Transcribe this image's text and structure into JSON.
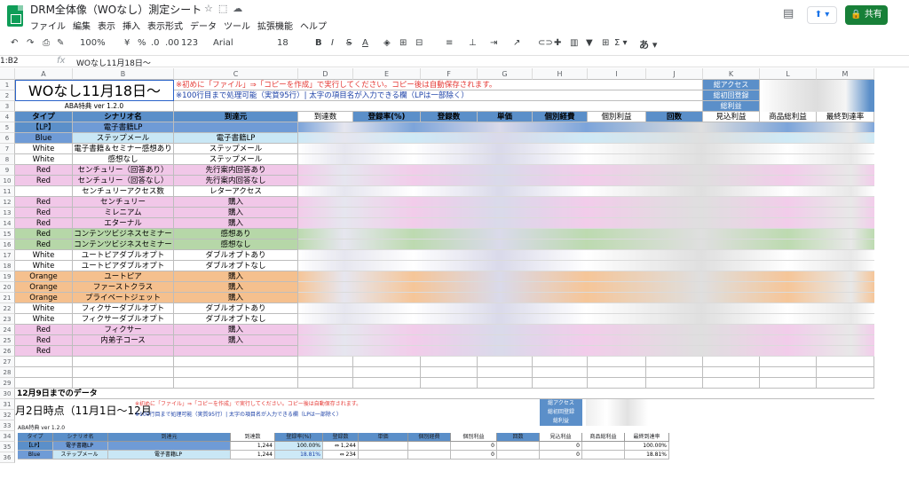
{
  "app": {
    "doc_title": "DRM全体像（WOなし）測定シート",
    "menus": [
      "ファイル",
      "編集",
      "表示",
      "挿入",
      "表示形式",
      "データ",
      "ツール",
      "拡張機能",
      "ヘルプ"
    ],
    "share_label": "共有"
  },
  "toolbar": {
    "zoom": "100%",
    "currency": "¥",
    "percent": "%",
    "dec_dec": ".0",
    "dec_inc": ".00",
    "number_format": "123",
    "font": "Arial",
    "font_size": "18"
  },
  "formula": {
    "namebox": "1:B2",
    "fx": "fx",
    "content": "WOなし11月18日〜"
  },
  "columns": [
    "A",
    "B",
    "C",
    "D",
    "E",
    "F",
    "G",
    "H",
    "I",
    "J",
    "K",
    "L",
    "M"
  ],
  "sheet": {
    "big_title": "WOなし11月18日〜",
    "version": "ABA特典 ver 1.2.0",
    "note1": "※初めに「ファイル」⇒「コピーを作成」で実行してください。コピー後は自動保存されます。",
    "note2": "※100行目まで処理可能（実質95行）| 太字の項目名が入力できる欄（LPは一部除く）",
    "k_labels": [
      "総アクセス",
      "総初回登録",
      "総利益"
    ],
    "headers": [
      "タイプ",
      "シナリオ名",
      "到達元",
      "到達数",
      "登録率(%)",
      "登録数",
      "単価",
      "個別経費",
      "個別利益",
      "回数",
      "見込利益",
      "商品総利益",
      "最終到達率"
    ],
    "rows": [
      {
        "type": "【LP】",
        "scenario": "電子書籍LP",
        "source": ""
      },
      {
        "type": "Blue",
        "scenario": "ステップメール",
        "source": "電子書籍LP"
      },
      {
        "type": "White",
        "scenario": "電子書籍＆セミナー感想あり",
        "source": "ステップメール"
      },
      {
        "type": "White",
        "scenario": "感想なし",
        "source": "ステップメール"
      },
      {
        "type": "Red",
        "scenario": "センチュリー（回答あり）",
        "source": "先行案内回答あり"
      },
      {
        "type": "Red",
        "scenario": "センチュリー（回答なし）",
        "source": "先行案内回答なし"
      },
      {
        "type": "",
        "scenario": "センチュリーアクセス数",
        "source": "レターアクセス"
      },
      {
        "type": "Red",
        "scenario": "センチュリー",
        "source": "購入"
      },
      {
        "type": "Red",
        "scenario": "ミレニアム",
        "source": "購入"
      },
      {
        "type": "Red",
        "scenario": "エターナル",
        "source": "購入"
      },
      {
        "type": "Red",
        "scenario": "コンテンツビジネスセミナー",
        "source": "感想あり"
      },
      {
        "type": "Red",
        "scenario": "コンテンツビジネスセミナー",
        "source": "感想なし"
      },
      {
        "type": "White",
        "scenario": "ユートピアダブルオプト",
        "source": "ダブルオプトあり"
      },
      {
        "type": "White",
        "scenario": "ユートピアダブルオプト",
        "source": "ダブルオプトなし"
      },
      {
        "type": "Orange",
        "scenario": "ユートピア",
        "source": "購入"
      },
      {
        "type": "Orange",
        "scenario": "ファーストクラス",
        "source": "購入"
      },
      {
        "type": "Orange",
        "scenario": "プライベートジェット",
        "source": "購入"
      },
      {
        "type": "White",
        "scenario": "フィクサーダブルオプト",
        "source": "ダブルオプトあり"
      },
      {
        "type": "White",
        "scenario": "フィクサーダブルオプト",
        "source": "ダブルオプトなし"
      },
      {
        "type": "Red",
        "scenario": "フィクサー",
        "source": "購入"
      },
      {
        "type": "Red",
        "scenario": "内弟子コース",
        "source": "購入"
      },
      {
        "type": "Red",
        "scenario": "",
        "source": ""
      }
    ],
    "section2_title": "12月9日までのデータ",
    "section2_subtitle": "月2日時点（11月1日〜12月",
    "mini_note1": "※初めに「ファイル」⇒「コピーを作成」で実行してください。コピー後は自動保存されます。",
    "mini_note2": "※100行目まで処理可能（実質95行）| 太字の項目名が入力できる欄（LPは一部除く）",
    "mini_version": "ABA特典 ver 1.2.0",
    "mini_k_labels": [
      "総アクセス",
      "総初回登録",
      "総利益"
    ],
    "mini_headers": [
      "タイプ",
      "シナリオ名",
      "到達元",
      "到達数",
      "登録率(%)",
      "登録数",
      "単価",
      "個別経費",
      "個別利益",
      "回数",
      "見込利益",
      "商品総利益",
      "最終到達率"
    ],
    "mini_rows": [
      {
        "type": "【LP】",
        "scenario": "電子書籍LP",
        "source": "",
        "reach": "1,244",
        "rate": "100.00%",
        "reg": "⇔ 1,244",
        "exp": "0",
        "profit": "0",
        "final": "100.00%"
      },
      {
        "type": "Blue",
        "scenario": "ステップメール",
        "source": "電子書籍LP",
        "reach": "1,244",
        "rate": "18.81%",
        "reg": "⇔ 234",
        "exp": "0",
        "profit": "0",
        "final": "18.81%"
      }
    ],
    "row_numbers": [
      "1",
      "2",
      "3",
      "4",
      "5",
      "6",
      "7",
      "8",
      "9",
      "10",
      "11",
      "12",
      "13",
      "14",
      "15",
      "16",
      "17",
      "18",
      "19",
      "20",
      "21",
      "22",
      "23",
      "24",
      "25",
      "26",
      "27",
      "28",
      "29",
      "30",
      "31",
      "32",
      "33",
      "34",
      "35",
      "36"
    ]
  },
  "colors": {
    "header_blue": "#5b8fc9",
    "lp_blue": "#6f9bd6",
    "light_blue": "#c9e7f5",
    "pink": "#f1c7e8",
    "green": "#b6d7a8",
    "orange": "#f5c08e",
    "white": "#ffffff",
    "share_green": "#188038"
  }
}
